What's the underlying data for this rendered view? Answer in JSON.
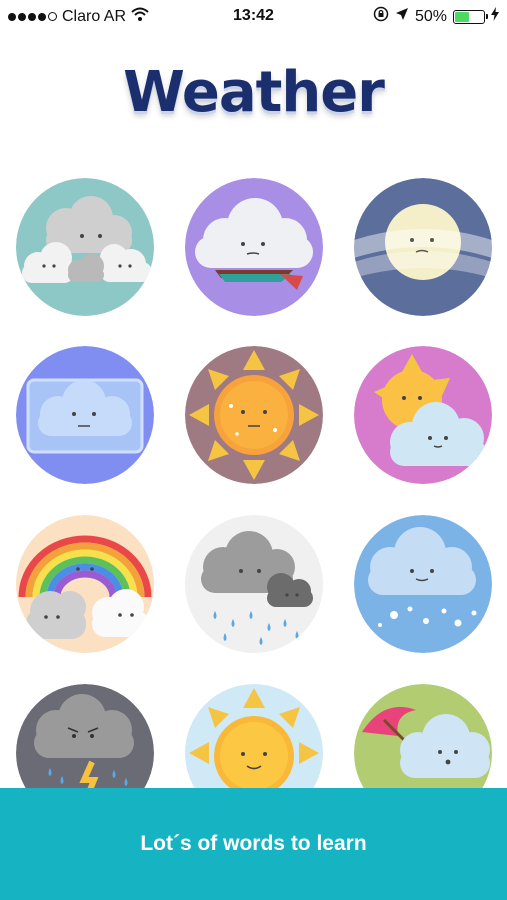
{
  "status_bar": {
    "carrier": "Claro AR",
    "time": "13:42",
    "battery": "50%",
    "battery_level": 0.5,
    "icons": [
      "signal-dots-icon",
      "wifi-icon",
      "rotation-lock-icon",
      "location-arrow-icon",
      "battery-icon",
      "charging-bolt-icon"
    ]
  },
  "header": {
    "title": "Weather"
  },
  "tiles": [
    {
      "name": "cloudy",
      "bg": "#8ec8c6"
    },
    {
      "name": "windy-cloud",
      "bg": "#a98ee6"
    },
    {
      "name": "fog",
      "bg": "#5c6e9c"
    },
    {
      "name": "freezing",
      "bg": "#7f8ef0"
    },
    {
      "name": "hot-sun",
      "bg": "#a07a82"
    },
    {
      "name": "partly-sunny",
      "bg": "#d77bcd"
    },
    {
      "name": "rainbow",
      "bg": "#fbe0c2"
    },
    {
      "name": "rain",
      "bg": "#f0f0f0"
    },
    {
      "name": "snow",
      "bg": "#7cb3e6"
    },
    {
      "name": "storm",
      "bg": "#6b6b75"
    },
    {
      "name": "sunny",
      "bg": "#cfe9f7"
    },
    {
      "name": "umbrella-cloud",
      "bg": "#b2cc72"
    }
  ],
  "banner": {
    "text": "Lot´s of words to learn"
  }
}
